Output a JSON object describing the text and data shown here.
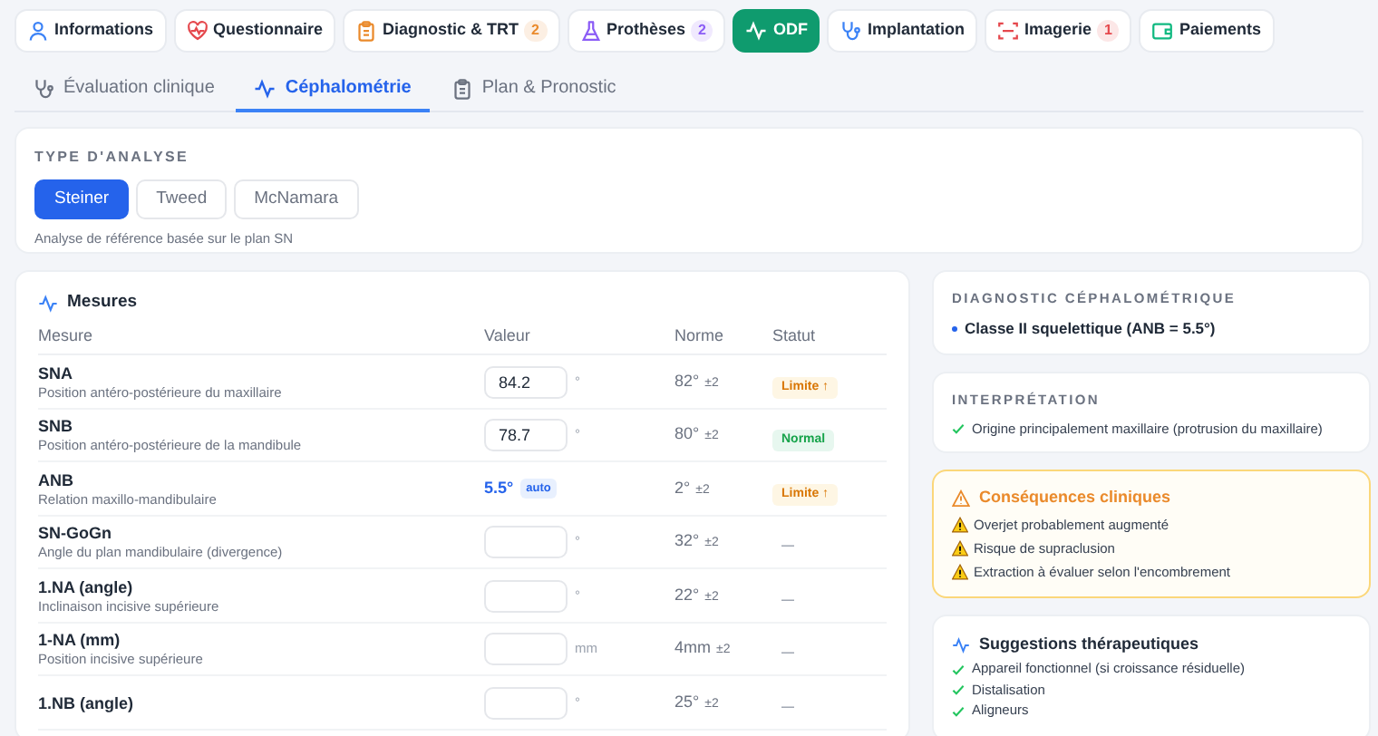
{
  "nav_tabs": [
    {
      "label": "Informations",
      "selected": false
    },
    {
      "label": "Questionnaire",
      "selected": false
    },
    {
      "label": "Diagnostic & TRT",
      "selected": false,
      "badge": {
        "text": "2",
        "color": "#ea8a2b"
      }
    },
    {
      "label": "Prothèses",
      "selected": false,
      "badge": {
        "text": "2",
        "color": "#8b5cf6"
      }
    },
    {
      "label": "ODF",
      "selected": true
    },
    {
      "label": "Implantation",
      "selected": false
    },
    {
      "label": "Imagerie",
      "selected": false,
      "badge": {
        "text": "1",
        "color": "#e5484d"
      }
    },
    {
      "label": "Paiements",
      "selected": false
    }
  ],
  "sub_tabs": [
    {
      "label": "Évaluation clinique",
      "selected": false
    },
    {
      "label": "Céphalométrie",
      "selected": true
    },
    {
      "label": "Plan & Pronostic",
      "selected": false
    }
  ],
  "analysis_type": {
    "title": "TYPE D'ANALYSE",
    "options": [
      {
        "label": "Steiner",
        "selected": true
      },
      {
        "label": "Tweed",
        "selected": false
      },
      {
        "label": "McNamara",
        "selected": false
      }
    ],
    "note": "Analyse de référence basée sur le plan SN"
  },
  "measures": {
    "title": "Mesures",
    "columns": [
      "Mesure",
      "Valeur",
      "Norme",
      "Statut"
    ],
    "rows": [
      {
        "name": "SNA",
        "desc": "Position antéro-postérieure du maxillaire",
        "kind": "input",
        "value": "84.2",
        "unit": "°",
        "norm": "82°",
        "tolerance": "±2",
        "status": {
          "kind": "limit",
          "text": "Limite ↑"
        }
      },
      {
        "name": "SNB",
        "desc": "Position antéro-postérieure de la mandibule",
        "kind": "input",
        "value": "78.7",
        "unit": "°",
        "norm": "80°",
        "tolerance": "±2",
        "status": {
          "kind": "normal",
          "text": "Normal"
        }
      },
      {
        "name": "ANB",
        "desc": "Relation maxillo-mandibulaire",
        "kind": "auto",
        "value": "5.5°",
        "auto_label": "auto",
        "norm": "2°",
        "tolerance": "±2",
        "status": {
          "kind": "limit",
          "text": "Limite ↑"
        }
      },
      {
        "name": "SN-GoGn",
        "desc": "Angle du plan mandibulaire (divergence)",
        "kind": "input",
        "unit": "°",
        "norm": "32°",
        "tolerance": "±2",
        "status": {
          "kind": "none",
          "text": "—"
        }
      },
      {
        "name": "1.NA (angle)",
        "desc": "Inclinaison incisive supérieure",
        "kind": "input",
        "unit": "°",
        "norm": "22°",
        "tolerance": "±2",
        "status": {
          "kind": "none",
          "text": "—"
        }
      },
      {
        "name": "1-NA (mm)",
        "desc": "Position incisive supérieure",
        "kind": "input",
        "unit": "mm",
        "norm": "4mm",
        "tolerance": "±2",
        "status": {
          "kind": "none",
          "text": "—"
        }
      },
      {
        "name": "1.NB (angle)",
        "kind": "input",
        "unit": "°",
        "norm": "25°",
        "tolerance": "±2",
        "status": {
          "kind": "none",
          "text": "—"
        }
      }
    ]
  },
  "diagnostic": {
    "title": "DIAGNOSTIC CÉPHALOMÉTRIQUE",
    "items": [
      "Classe II squelettique (ANB = 5.5°)"
    ]
  },
  "interpretation": {
    "title": "INTERPRÉTATION",
    "items": [
      "Origine principalement maxillaire (protrusion du maxillaire)"
    ]
  },
  "consequences": {
    "title": "Conséquences cliniques",
    "items": [
      "Overjet probablement augmenté",
      "Risque de supraclusion",
      "Extraction à évaluer selon l'encombrement"
    ]
  },
  "suggestions": {
    "title": "Suggestions thérapeutiques",
    "items": [
      "Appareil fonctionnel (si croissance résiduelle)",
      "Distalisation",
      "Aligneurs"
    ]
  }
}
